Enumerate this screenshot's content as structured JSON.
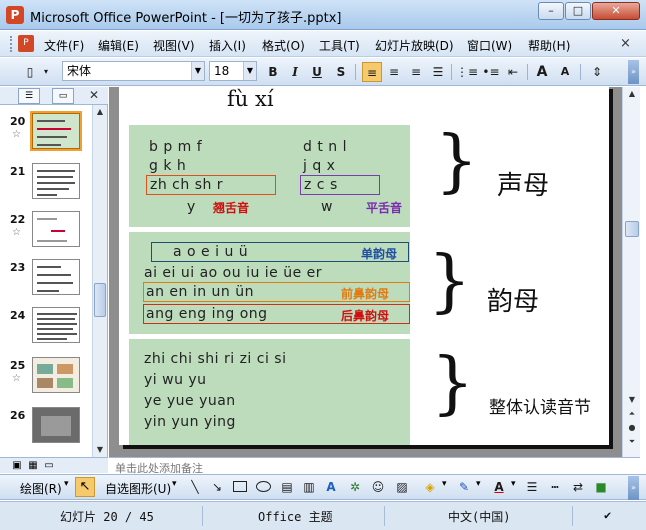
{
  "window": {
    "title": "Microsoft Office PowerPoint - [一切为了孩子.pptx]",
    "minimize": "–",
    "maximize": "□",
    "close": "✕"
  },
  "menu": {
    "items": [
      "文件(F)",
      "编辑(E)",
      "视图(V)",
      "插入(I)",
      "格式(O)",
      "工具(T)",
      "幻灯片放映(D)",
      "窗口(W)",
      "帮助(H)"
    ],
    "close": "×"
  },
  "toolbar": {
    "font": "宋体",
    "size": "18",
    "bold": "B",
    "italic": "I",
    "underline": "U",
    "shadow": "S",
    "grow": "A",
    "shrink": "A"
  },
  "outline": {
    "slides": [
      {
        "num": "20",
        "star": "☆",
        "selected": true
      },
      {
        "num": "21",
        "star": "",
        "selected": false
      },
      {
        "num": "22",
        "star": "☆",
        "selected": false
      },
      {
        "num": "23",
        "star": "",
        "selected": false
      },
      {
        "num": "24",
        "star": "",
        "selected": false
      },
      {
        "num": "25",
        "star": "☆",
        "selected": false
      },
      {
        "num": "26",
        "star": "",
        "selected": false
      }
    ]
  },
  "slide": {
    "heading": "fù   xí",
    "initials": {
      "row1": "b   p   m   f",
      "row1b": "d   t   n   l",
      "row2": "g   k   h",
      "row2b": "j   q   x",
      "retroflex": "zh   ch   sh   r",
      "flat": "z   c   s",
      "y": "y",
      "w": "w",
      "retroflex_label": "翘舌音",
      "flat_label": "平舌音",
      "category": "声母"
    },
    "finals": {
      "simple": "a    o    e         i    u    ü",
      "simple_label": "单韵母",
      "row2": "ai  ei  ui  ao  ou  iu  ie  üe  er",
      "front": "an    en    in    un    ün",
      "front_label": "前鼻韵母",
      "back": "ang      eng      ing      ong",
      "back_label": "后鼻韵母",
      "category": "韵母"
    },
    "whole": {
      "row1": "zhi    chi    shi    ri    zi    ci    si",
      "row2": "yi      wu      yu",
      "row3": "ye      yue      yuan",
      "row4": "yin      yun      ying",
      "category": "整体认读音节"
    }
  },
  "notes": {
    "placeholder": "单击此处添加备注"
  },
  "drawing": {
    "draw": "绘图(R)",
    "autoshapes": "自选图形(U)"
  },
  "status": {
    "slide": "幻灯片 20 / 45",
    "theme": "Office 主题",
    "language": "中文(中国)"
  }
}
